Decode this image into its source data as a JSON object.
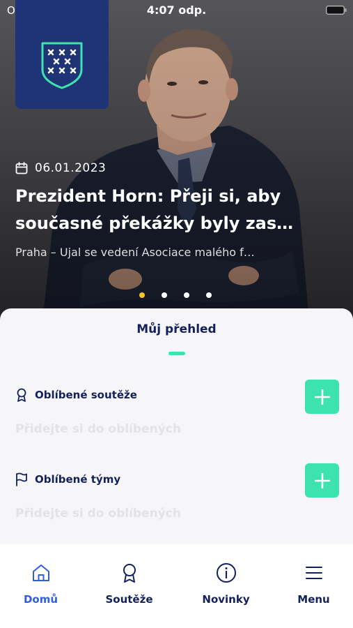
{
  "status_bar": {
    "carrier": "Operátor",
    "time": "4:07 odp."
  },
  "hero": {
    "date": "06.01.2023",
    "title_line1": "Prezident Horn: Přeji si, aby",
    "title_line2": "současné překážky byly zas…",
    "excerpt": "Praha – Ujal se vedení Asociace malého f…",
    "pager": {
      "total": 4,
      "active_index": 0
    }
  },
  "overview": {
    "title": "Můj přehled",
    "favorite_competitions": {
      "label": "Oblíbené soutěže",
      "empty_text": "Přidejte si do oblíbených"
    },
    "favorite_teams": {
      "label": "Oblíbené týmy",
      "empty_text": "Přidejte si do oblíbených"
    }
  },
  "tabbar": {
    "items": [
      {
        "label": "Domů",
        "icon": "home-icon",
        "active": true
      },
      {
        "label": "Soutěže",
        "icon": "award-icon",
        "active": false
      },
      {
        "label": "Novinky",
        "icon": "info-icon",
        "active": false
      },
      {
        "label": "Menu",
        "icon": "menu-icon",
        "active": false
      }
    ]
  },
  "colors": {
    "navy": "#14215a",
    "crest_blue": "#1f3377",
    "accent_green": "#3de3ad",
    "active_blue": "#2d5fe0",
    "pager_active": "#f5c52c"
  }
}
